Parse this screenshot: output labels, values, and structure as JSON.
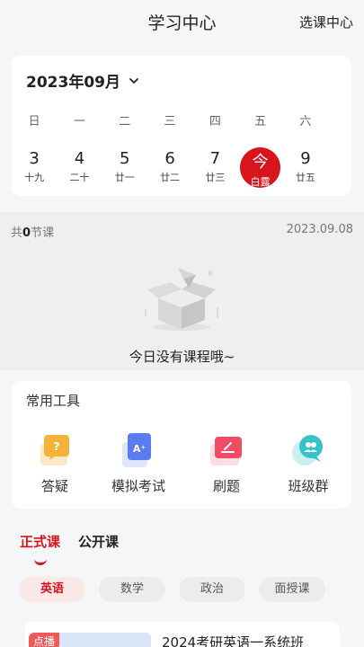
{
  "header": {
    "title": "学习中心",
    "right_action": "选课中心"
  },
  "calendar": {
    "month_label": "2023年09月",
    "weekdays": [
      "日",
      "一",
      "二",
      "三",
      "四",
      "五",
      "六"
    ],
    "days": [
      {
        "num": "3",
        "lunar": "十九"
      },
      {
        "num": "4",
        "lunar": "二十"
      },
      {
        "num": "5",
        "lunar": "廿一"
      },
      {
        "num": "6",
        "lunar": "廿二"
      },
      {
        "num": "7",
        "lunar": "廿三"
      },
      {
        "num": "今",
        "lunar": "白露",
        "today": true
      },
      {
        "num": "9",
        "lunar": "廿五"
      }
    ]
  },
  "schedule": {
    "count_prefix": "共",
    "count": "0",
    "count_suffix": "节课",
    "date": "2023.09.08",
    "empty_text": "今日没有课程哦~"
  },
  "tools": {
    "title": "常用工具",
    "items": [
      {
        "label": "答疑",
        "icon": "qa-icon",
        "color": "#f5b23a"
      },
      {
        "label": "模拟考试",
        "icon": "mock-exam-icon",
        "color": "#5b7cf0"
      },
      {
        "label": "刷题",
        "icon": "practice-icon",
        "color": "#ef4d63"
      },
      {
        "label": "班级群",
        "icon": "class-group-icon",
        "color": "#33c3c8"
      }
    ]
  },
  "course_tabs": [
    {
      "label": "正式课",
      "active": true
    },
    {
      "label": "公开课",
      "active": false
    }
  ],
  "subjects": [
    {
      "label": "英语",
      "active": true
    },
    {
      "label": "数学",
      "active": false
    },
    {
      "label": "政治",
      "active": false
    },
    {
      "label": "面授课",
      "active": false
    }
  ],
  "course": {
    "tag": "点播",
    "title": "2024考研英语一系统班"
  },
  "colors": {
    "accent": "#d8141d",
    "background": "#f5f6f8"
  }
}
